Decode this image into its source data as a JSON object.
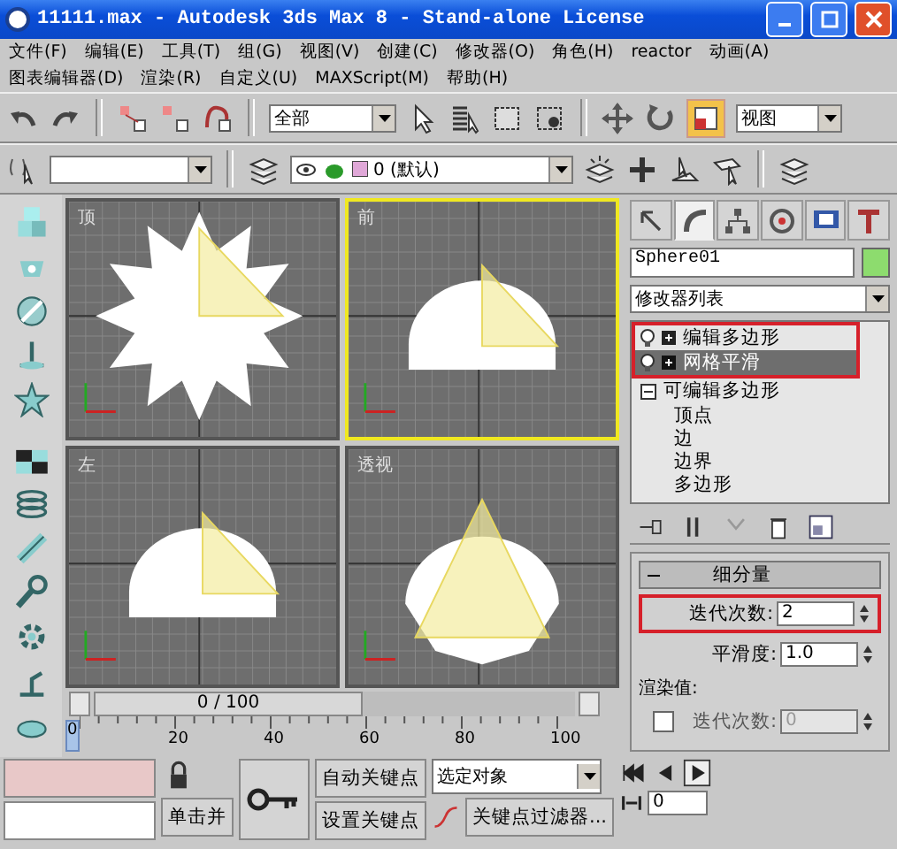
{
  "window": {
    "title": "11111.max - Autodesk 3ds Max 8  - Stand-alone License"
  },
  "menu_rows": [
    [
      "文件(F)",
      "编辑(E)",
      "工具(T)",
      "组(G)",
      "视图(V)",
      "创建(C)",
      "修改器(O)",
      "角色(H)",
      "reactor",
      "动画(A)"
    ],
    [
      "图表编辑器(D)",
      "渲染(R)",
      "自定义(U)",
      "MAXScript(M)",
      "帮助(H)"
    ]
  ],
  "main_toolbar": {
    "selection_filter": "全部",
    "reference_coord": "视图"
  },
  "layer_toolbar": {
    "layer": "0 (默认)"
  },
  "viewports": [
    {
      "label": "顶",
      "kind": "top",
      "selected": false
    },
    {
      "label": "前",
      "kind": "front",
      "selected": true
    },
    {
      "label": "左",
      "kind": "left",
      "selected": false
    },
    {
      "label": "透视",
      "kind": "perspective",
      "selected": false
    }
  ],
  "time_slider": {
    "label": "0 / 100",
    "level": 0
  },
  "track_bar": {
    "current": "0",
    "ticks": [
      "20",
      "40",
      "60",
      "80",
      "100"
    ]
  },
  "command_panel": {
    "tabs": [
      {
        "kind": "create",
        "selected": false
      },
      {
        "kind": "modify",
        "selected": true
      },
      {
        "kind": "hierarchy",
        "selected": false
      },
      {
        "kind": "motion",
        "selected": false
      },
      {
        "kind": "display",
        "selected": false
      },
      {
        "kind": "utilities",
        "selected": false
      }
    ],
    "object_name": "Sphere01",
    "modifier_list": "修改器列表",
    "stack": [
      {
        "kind": "modifier",
        "label": "编辑多边形",
        "on": true,
        "selected": false,
        "callout": true
      },
      {
        "kind": "modifier",
        "label": "网格平滑",
        "on": true,
        "selected": true,
        "callout": true
      },
      {
        "kind": "base",
        "label": "可编辑多边形",
        "expanded": true,
        "selected": false,
        "children": [
          {
            "label": "顶点"
          },
          {
            "label": "边"
          },
          {
            "label": "边界"
          },
          {
            "label": "多边形"
          }
        ]
      }
    ],
    "rollout": {
      "title": "细分量",
      "expanded": true,
      "params": [
        {
          "label": "迭代次数:",
          "value": "2",
          "callout": true
        },
        {
          "label": "平滑度:",
          "value": "1.0",
          "callout": false
        }
      ],
      "render_group": "渲染值:",
      "render_iterations": {
        "label": "迭代次数:",
        "value": "0",
        "checked": false,
        "disabled": true
      }
    }
  },
  "status_bar": {
    "prompt": "单击并",
    "auto_key": "自动关键点",
    "set_key": "设置关键点",
    "key_mode": "选定对象",
    "key_filters": "关键点过滤器...",
    "frame": "0"
  }
}
